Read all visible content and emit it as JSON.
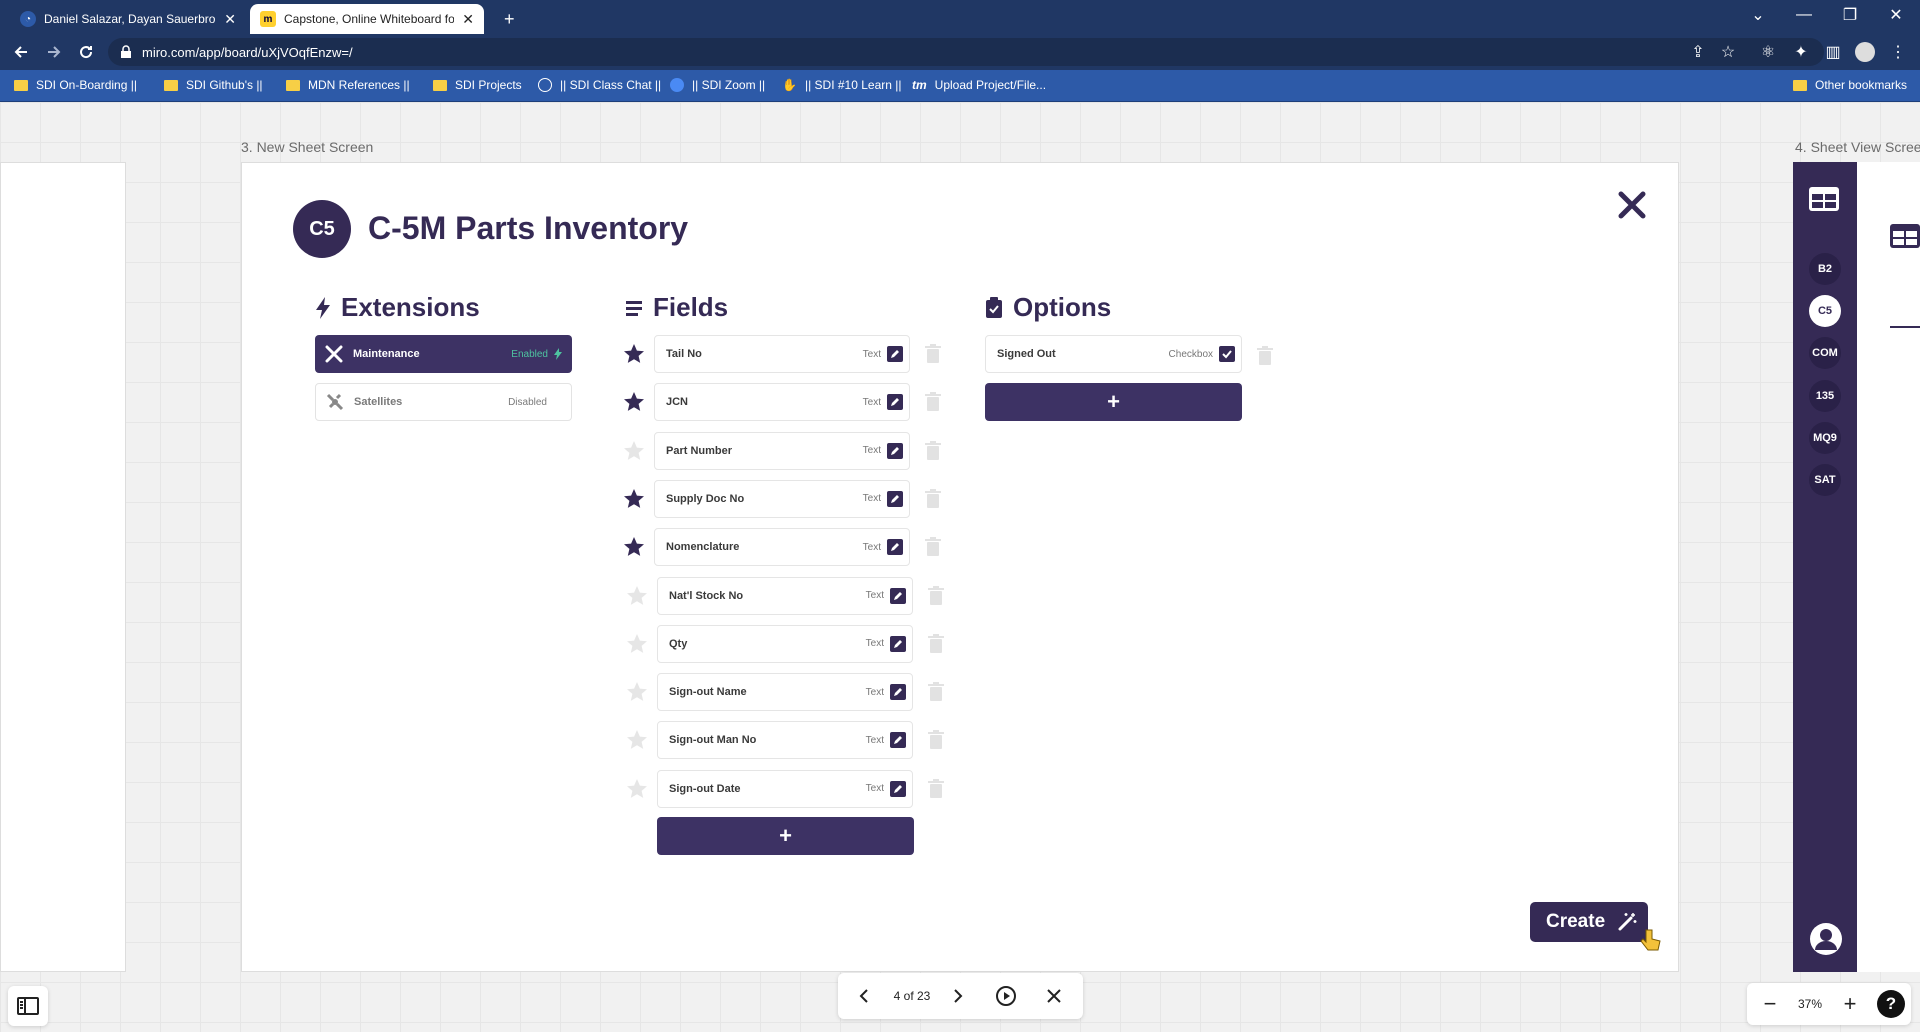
{
  "browser": {
    "tabs": [
      {
        "title": "Daniel Salazar, Dayan Sauerbronn"
      },
      {
        "title": "Capstone, Online Whiteboard for"
      }
    ],
    "url": "miro.com/app/board/uXjVOqfEnzw=/",
    "bookmarks": [
      "SDI On-Boarding ||",
      "SDI Github's ||",
      "MDN References ||",
      "SDI Projects",
      "|| SDI Class Chat ||",
      "|| SDI Zoom ||",
      "|| SDI #10 Learn ||",
      "Upload Project/File...",
      "Other bookmarks"
    ]
  },
  "board": {
    "frame_left_label": "3. New Sheet Screen",
    "frame_right_label": "4. Sheet View Scree",
    "logo": "C5",
    "title": "C-5M Parts Inventory",
    "extensions_heading": "Extensions",
    "fields_heading": "Fields",
    "options_heading": "Options",
    "extensions": [
      {
        "name": "Maintenance",
        "status": "Enabled",
        "enabled": true
      },
      {
        "name": "Satellites",
        "status": "Disabled",
        "enabled": false
      }
    ],
    "fields": [
      {
        "name": "Tail No",
        "type": "Text",
        "starred": true
      },
      {
        "name": "JCN",
        "type": "Text",
        "starred": true
      },
      {
        "name": "Part Number",
        "type": "Text",
        "starred": false
      },
      {
        "name": "Supply Doc No",
        "type": "Text",
        "starred": true
      },
      {
        "name": "Nomenclature",
        "type": "Text",
        "starred": true
      },
      {
        "name": "Nat'l Stock No",
        "type": "Text",
        "starred": false
      },
      {
        "name": "Qty",
        "type": "Text",
        "starred": false
      },
      {
        "name": "Sign-out Name",
        "type": "Text",
        "starred": false
      },
      {
        "name": "Sign-out Man No",
        "type": "Text",
        "starred": false
      },
      {
        "name": "Sign-out Date",
        "type": "Text",
        "starred": false
      }
    ],
    "options": [
      {
        "name": "Signed Out",
        "type": "Checkbox",
        "checked": true
      }
    ],
    "add_symbol": "+",
    "create_label": "Create",
    "sidebar": {
      "items": [
        "B2",
        "C5",
        "COM",
        "135",
        "MQ9",
        "SAT"
      ],
      "selected": "C5"
    }
  },
  "controls": {
    "page_label": "4 of 23",
    "zoom": "37%"
  },
  "colors": {
    "accent": "#352a55",
    "enabled_text": "#4ec3a0",
    "browser_bar": "#203764",
    "bookmark_bar": "#2d5aa8"
  }
}
